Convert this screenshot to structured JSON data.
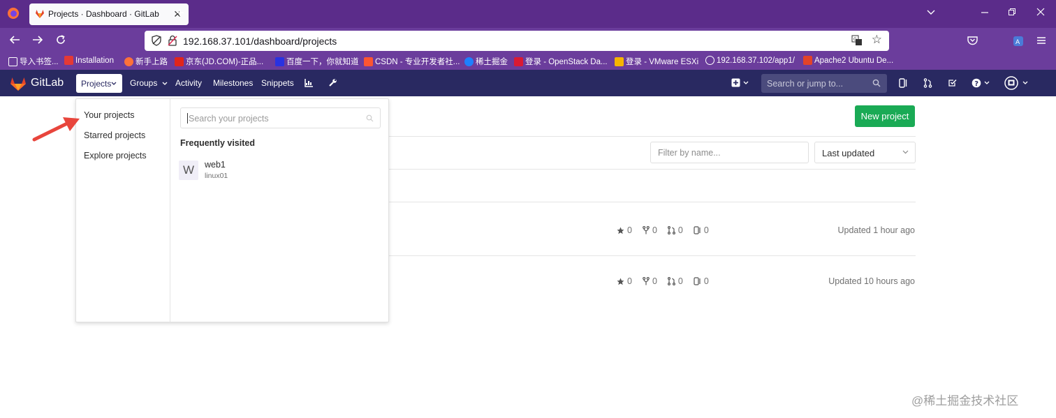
{
  "browser": {
    "tab_title": "Projects · Dashboard · GitLab",
    "url": "192.168.37.101/dashboard/projects",
    "bookmarks": [
      {
        "label": "导入书签...",
        "color": "#ffffff"
      },
      {
        "label": "Installation",
        "color": "#e53935"
      },
      {
        "label": "新手上路",
        "color": "#ff7139"
      },
      {
        "label": "京东(JD.COM)-正品...",
        "color": "#e1251b"
      },
      {
        "label": "百度一下，你就知道",
        "color": "#2932e1"
      },
      {
        "label": "CSDN - 专业开发者社...",
        "color": "#fc5531"
      },
      {
        "label": "稀土掘金",
        "color": "#1e80ff"
      },
      {
        "label": "登录 - OpenStack Da...",
        "color": "#da1a32"
      },
      {
        "label": "登录 - VMware ESXi",
        "color": "#f5b400"
      },
      {
        "label": "192.168.37.102/app1/",
        "color": "#ffffff"
      },
      {
        "label": "Apache2 Ubuntu De...",
        "color": "#e24329"
      }
    ]
  },
  "gitlab": {
    "brand": "GitLab",
    "nav": {
      "projects": "Projects",
      "groups": "Groups",
      "activity": "Activity",
      "milestones": "Milestones",
      "snippets": "Snippets"
    },
    "search_placeholder": "Search or jump to..."
  },
  "main": {
    "new_project": "New project",
    "filter_placeholder": "Filter by name...",
    "sort_selected": "Last updated",
    "projects": [
      {
        "stars": "0",
        "forks": "0",
        "merge_requests": "0",
        "issues": "0",
        "updated": "Updated 1 hour ago"
      },
      {
        "stars": "0",
        "forks": "0",
        "merge_requests": "0",
        "issues": "0",
        "updated": "Updated 10 hours ago"
      }
    ]
  },
  "dropdown": {
    "items": [
      "Your projects",
      "Starred projects",
      "Explore projects"
    ],
    "search_placeholder": "Search your projects",
    "heading": "Frequently visited",
    "frequent": [
      {
        "avatar": "W",
        "name": "web1",
        "namespace": "linux01"
      }
    ]
  },
  "watermark": "@稀土掘金技术社区"
}
